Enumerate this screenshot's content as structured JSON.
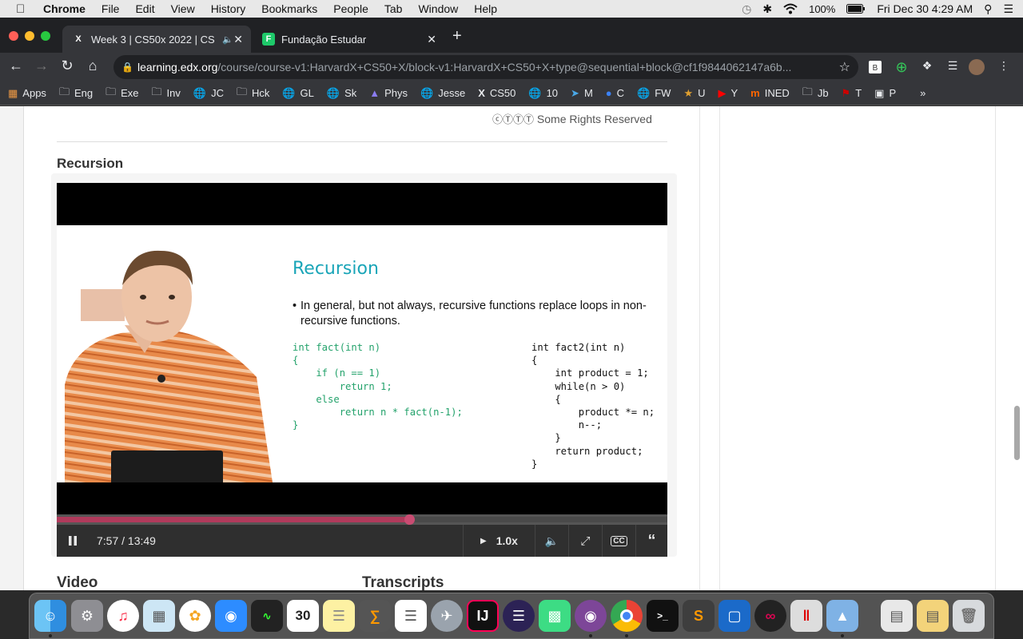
{
  "menubar": {
    "app": "Chrome",
    "items": [
      "File",
      "Edit",
      "View",
      "History",
      "Bookmarks",
      "People",
      "Tab",
      "Window",
      "Help"
    ],
    "battery": "100%",
    "datetime": "Fri Dec 30  4:29 AM"
  },
  "tabs": [
    {
      "title": "Week 3 | CS50x 2022 | CS",
      "favicon": "X",
      "active": true
    },
    {
      "title": "Fundação Estudar",
      "favicon": "F",
      "active": false
    }
  ],
  "address": {
    "host": "learning.edx.org",
    "path": "/course/course-v1:HarvardX+CS50+X/block-v1:HarvardX+CS50+X+type@sequential+block@cf1f9844062147a6b..."
  },
  "bookmarks": [
    {
      "label": "Apps",
      "icon": "grid-icon"
    },
    {
      "label": "Eng",
      "icon": "folder-icon"
    },
    {
      "label": "Exe",
      "icon": "folder-icon"
    },
    {
      "label": "Inv",
      "icon": "folder-icon"
    },
    {
      "label": "JC",
      "icon": "globe-icon"
    },
    {
      "label": "Hck",
      "icon": "folder-icon"
    },
    {
      "label": "GL",
      "icon": "globe-icon"
    },
    {
      "label": "Sk",
      "icon": "globe-icon"
    },
    {
      "label": "Phys",
      "icon": "phys-icon"
    },
    {
      "label": "Jesse",
      "icon": "globe-icon"
    },
    {
      "label": "CS50",
      "icon": "x-icon"
    },
    {
      "label": "10",
      "icon": "globe-icon"
    },
    {
      "label": "M",
      "icon": "m-icon"
    },
    {
      "label": "C",
      "icon": "c-icon"
    },
    {
      "label": "FW",
      "icon": "globe-icon"
    },
    {
      "label": "U",
      "icon": "u-icon"
    },
    {
      "label": "Y",
      "icon": "youtube-icon"
    },
    {
      "label": "INED",
      "icon": "ined-icon"
    },
    {
      "label": "Jb",
      "icon": "folder-icon"
    },
    {
      "label": "T",
      "icon": "t-icon"
    },
    {
      "label": "P",
      "icon": "p-icon"
    }
  ],
  "page": {
    "rights": "Some Rights Reserved",
    "section_title": "Recursion",
    "below_left": "Video",
    "below_right": "Transcripts"
  },
  "slide": {
    "title": "Recursion",
    "bullet": "In general, but not always, recursive functions replace loops in non-recursive functions.",
    "code_left": "int fact(int n)\n{\n    if (n == 1)\n        return 1;\n    else\n        return n * fact(n-1);\n}",
    "code_right": "int fact2(int n)\n{\n    int product = 1;\n    while(n > 0)\n    {\n        product *= n;\n        n--;\n    }\n    return product;\n}"
  },
  "player": {
    "time": "7:57 / 13:49",
    "speed": "1.0x",
    "progress_fraction": 0.577
  },
  "colors": {
    "accent_teal": "#1aa5b8",
    "code_green": "#23a26b",
    "progress": "#b03a5b"
  }
}
